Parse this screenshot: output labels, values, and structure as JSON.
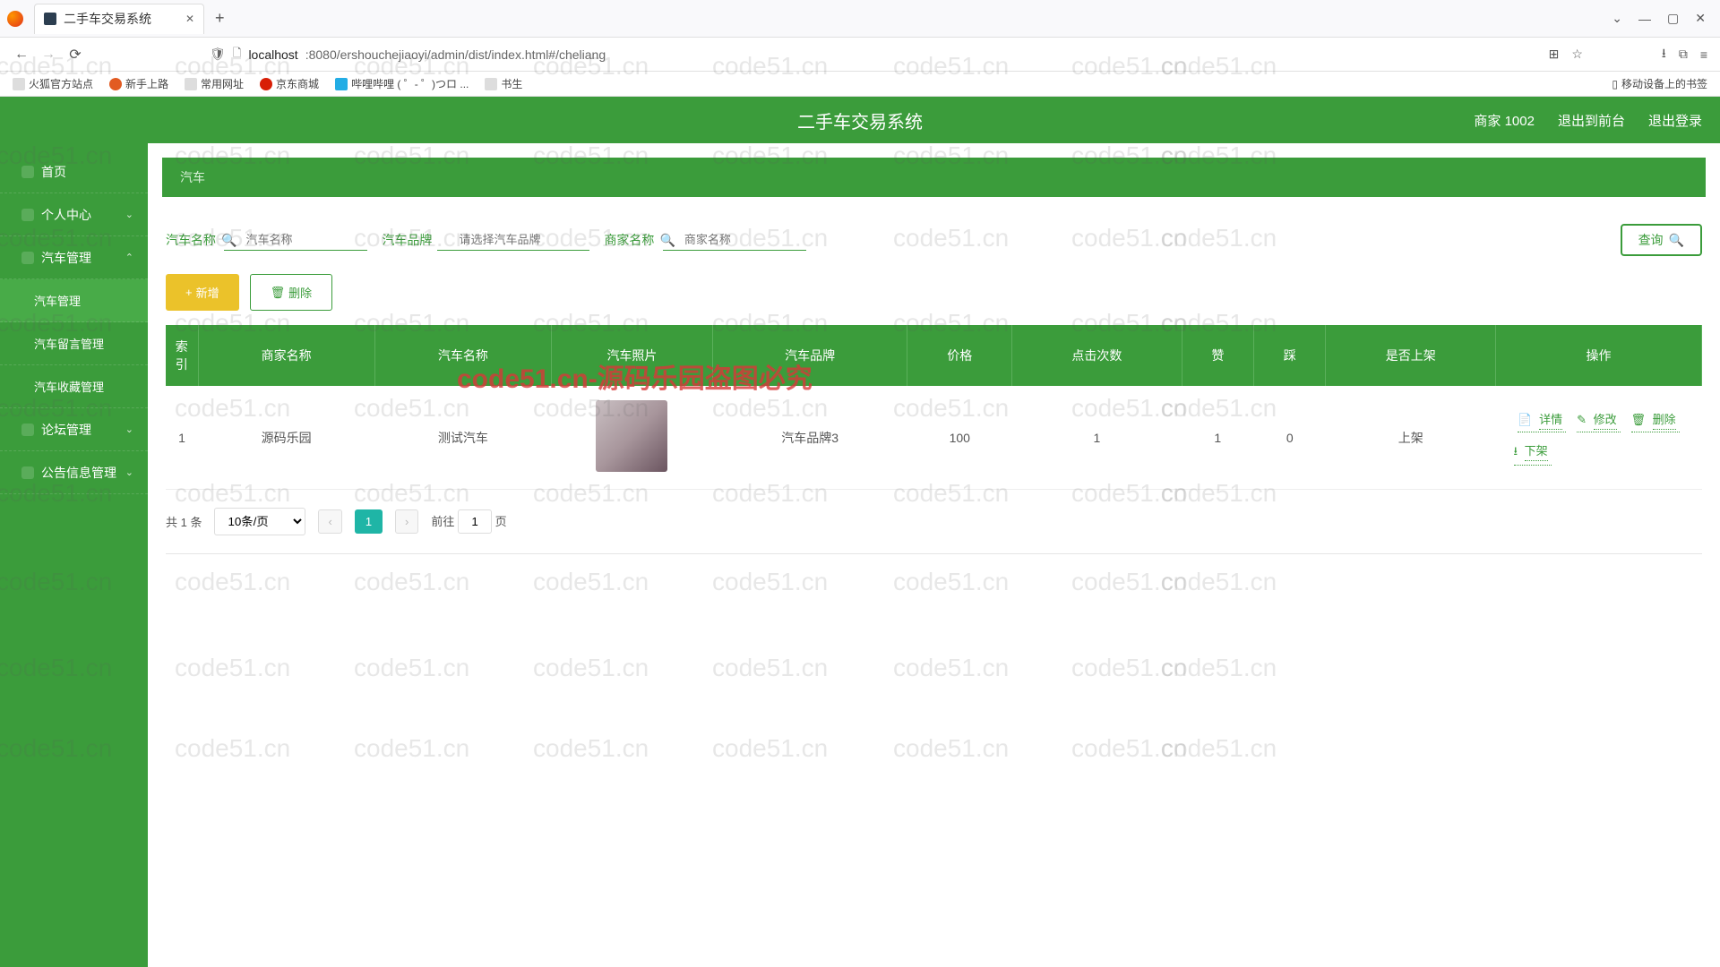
{
  "browser": {
    "tab_title": "二手车交易系统",
    "url_prefix": "localhost",
    "url_rest": ":8080/ershouchejiaoyi/admin/dist/index.html#/cheliang",
    "bookmarks": [
      "火狐官方站点",
      "新手上路",
      "常用网址",
      "京东商城",
      "哔哩哔哩 ( ゜- ゜)つロ ...",
      "书生"
    ],
    "mobile_bookmark": "移动设备上的书签"
  },
  "header": {
    "title": "二手车交易系统",
    "user": "商家 1002",
    "logout_front": "退出到前台",
    "logout_sys": "退出登录"
  },
  "sidebar": {
    "items": [
      {
        "label": "首页",
        "type": "item"
      },
      {
        "label": "个人中心",
        "type": "group",
        "chev": "⌄"
      },
      {
        "label": "汽车管理",
        "type": "group",
        "chev": "⌃"
      },
      {
        "label": "汽车管理",
        "type": "sub",
        "active": true
      },
      {
        "label": "汽车留言管理",
        "type": "sub"
      },
      {
        "label": "汽车收藏管理",
        "type": "sub"
      },
      {
        "label": "论坛管理",
        "type": "group",
        "chev": "⌄"
      },
      {
        "label": "公告信息管理",
        "type": "group",
        "chev": "⌄"
      }
    ]
  },
  "breadcrumb": "汽车",
  "filters": {
    "name_label": "汽车名称",
    "name_placeholder": "汽车名称",
    "brand_label": "汽车品牌",
    "brand_placeholder": "请选择汽车品牌",
    "seller_label": "商家名称",
    "seller_placeholder": "商家名称",
    "query_btn": "查询"
  },
  "actions": {
    "new_btn": "新增",
    "del_btn": "删除"
  },
  "table": {
    "headers": [
      "索引",
      "商家名称",
      "汽车名称",
      "汽车照片",
      "汽车品牌",
      "价格",
      "点击次数",
      "赞",
      "踩",
      "是否上架",
      "操作"
    ],
    "rows": [
      {
        "index": "1",
        "seller": "源码乐园",
        "name": "测试汽车",
        "brand": "汽车品牌3",
        "price": "100",
        "clicks": "1",
        "like": "1",
        "dislike": "0",
        "onshelf": "上架"
      }
    ],
    "ops": {
      "detail": "详情",
      "edit": "修改",
      "delete": "删除",
      "unshelf": "下架"
    }
  },
  "pager": {
    "total": "共 1 条",
    "per_page": "10条/页",
    "current": "1",
    "jump_pre": "前往",
    "jump_val": "1",
    "jump_suf": "页"
  },
  "watermark_text": "code51.cn",
  "big_watermark": "code51.cn-源码乐园盗图必究"
}
